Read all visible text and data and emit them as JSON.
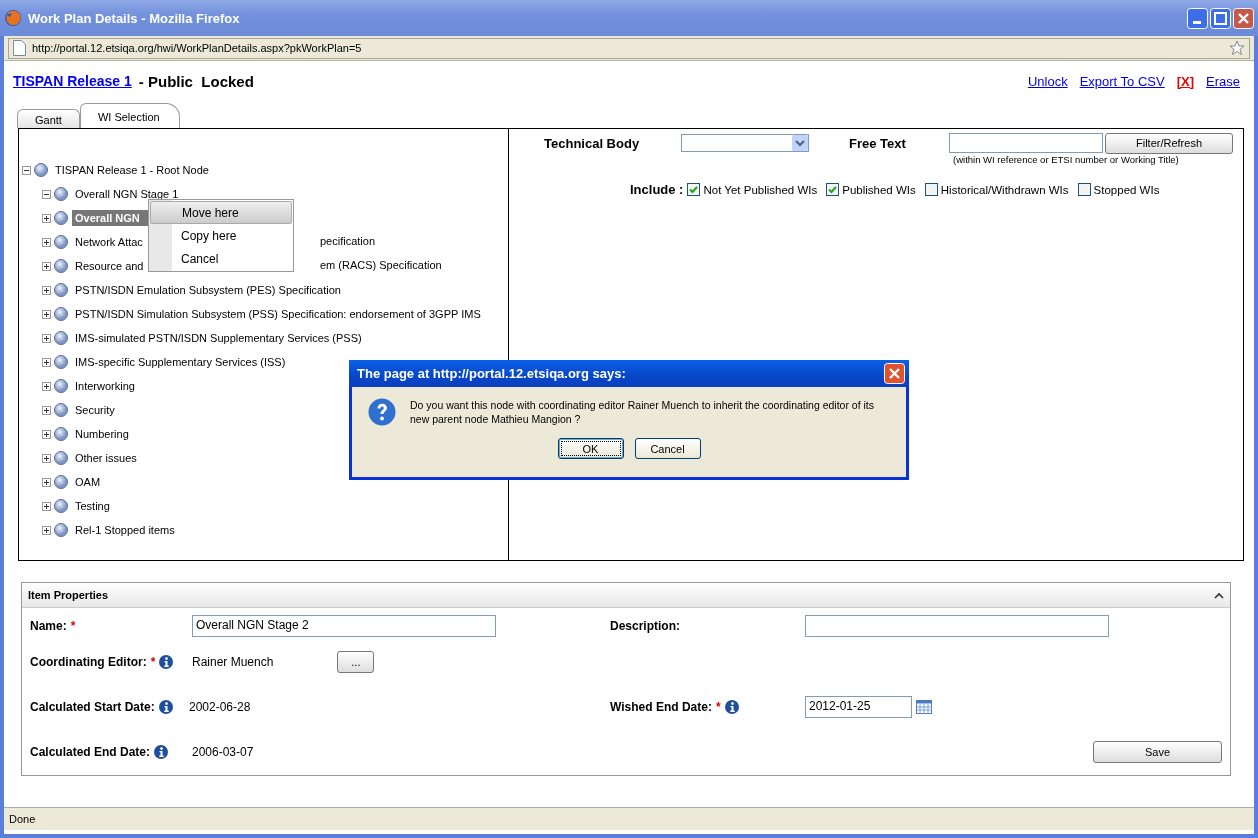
{
  "window": {
    "title": "Work Plan Details - Mozilla Firefox"
  },
  "address_bar": {
    "url": "http://portal.12.etsiqa.org/hwi/WorkPlanDetails.aspx?pkWorkPlan=5"
  },
  "header": {
    "release_link": "TISPAN Release 1",
    "title": "- Public  Locked",
    "actions": [
      {
        "label": "Unlock",
        "kind": "link"
      },
      {
        "label": "Export To CSV",
        "kind": "link"
      },
      {
        "label": "[X]",
        "kind": "danger"
      },
      {
        "label": "Erase",
        "kind": "link"
      }
    ]
  },
  "tabs": [
    {
      "label": "Gantt",
      "selected": false
    },
    {
      "label": "WI Selection",
      "selected": true
    }
  ],
  "tree": {
    "label": "TISPAN Release 1 - Root Node",
    "expanded": true,
    "children": [
      {
        "label": "Overall NGN Stage 1",
        "expanded": true,
        "selected": false
      },
      {
        "label": "Overall NGN",
        "expanded": false,
        "selected": true
      },
      {
        "label": "Network Attac",
        "tail": "pecification",
        "expanded": false,
        "selected": false
      },
      {
        "label": "Resource and",
        "tail": "em (RACS) Specification",
        "expanded": false,
        "selected": false
      },
      {
        "label": "PSTN/ISDN Emulation Subsystem (PES) Specification",
        "expanded": false,
        "selected": false
      },
      {
        "label": "PSTN/ISDN Simulation Subsystem (PSS) Specification: endorsement of 3GPP IMS",
        "expanded": false,
        "selected": false
      },
      {
        "label": "IMS-simulated PSTN/ISDN Supplementary Services (PSS)",
        "expanded": false,
        "selected": false
      },
      {
        "label": "IMS-specific Supplementary Services (ISS)",
        "expanded": false,
        "selected": false
      },
      {
        "label": "Interworking",
        "expanded": false,
        "selected": false
      },
      {
        "label": "Security",
        "expanded": false,
        "selected": false
      },
      {
        "label": "Numbering",
        "expanded": false,
        "selected": false
      },
      {
        "label": "Other issues",
        "expanded": false,
        "selected": false
      },
      {
        "label": "OAM",
        "expanded": false,
        "selected": false
      },
      {
        "label": "Testing",
        "expanded": false,
        "selected": false
      },
      {
        "label": "Rel-1 Stopped items",
        "expanded": false,
        "selected": false
      }
    ]
  },
  "context_menu": {
    "items": [
      {
        "label": "Move here",
        "selected": true
      },
      {
        "label": "Copy here",
        "selected": false
      },
      {
        "label": "Cancel",
        "selected": false
      }
    ]
  },
  "filters": {
    "technical_body_label": "Technical Body",
    "free_text_label": "Free Text",
    "filter_button": "Filter/Refresh",
    "hint": "(within WI reference or ETSI number or Working Title)",
    "include_label": "Include :",
    "options": [
      {
        "label": "Not Yet Published WIs",
        "checked": true
      },
      {
        "label": "Published WIs",
        "checked": true
      },
      {
        "label": "Historical/Withdrawn WIs",
        "checked": false
      },
      {
        "label": "Stopped WIs",
        "checked": false
      }
    ]
  },
  "dialog": {
    "title": "The page at http://portal.12.etsiqa.org says:",
    "message": "Do you want this node with coordinating editor Rainer Muench to inherit the coordinating editor of its new parent node Mathieu Mangion ?",
    "buttons": [
      {
        "label": "OK",
        "selected": true
      },
      {
        "label": "Cancel",
        "selected": false
      }
    ]
  },
  "item_properties": {
    "title": "Item Properties",
    "required_mark": "*",
    "name": {
      "label": "Name:",
      "required": true,
      "value": "Overall NGN Stage 2"
    },
    "description": {
      "label": "Description:",
      "required": false
    },
    "coordinating_editor": {
      "label": "Coordinating Editor:",
      "required": true,
      "value": "Rainer Muench",
      "browse_button": "..."
    },
    "calculated_start_date": {
      "label": "Calculated Start Date:",
      "value": "2002-06-28"
    },
    "wished_end_date": {
      "label": "Wished End Date:",
      "required": true,
      "value": "2012-01-25"
    },
    "calculated_end_date": {
      "label": "Calculated End Date:",
      "value": "2006-03-07"
    },
    "save_button": "Save"
  },
  "status_bar": {
    "text": "Done"
  }
}
